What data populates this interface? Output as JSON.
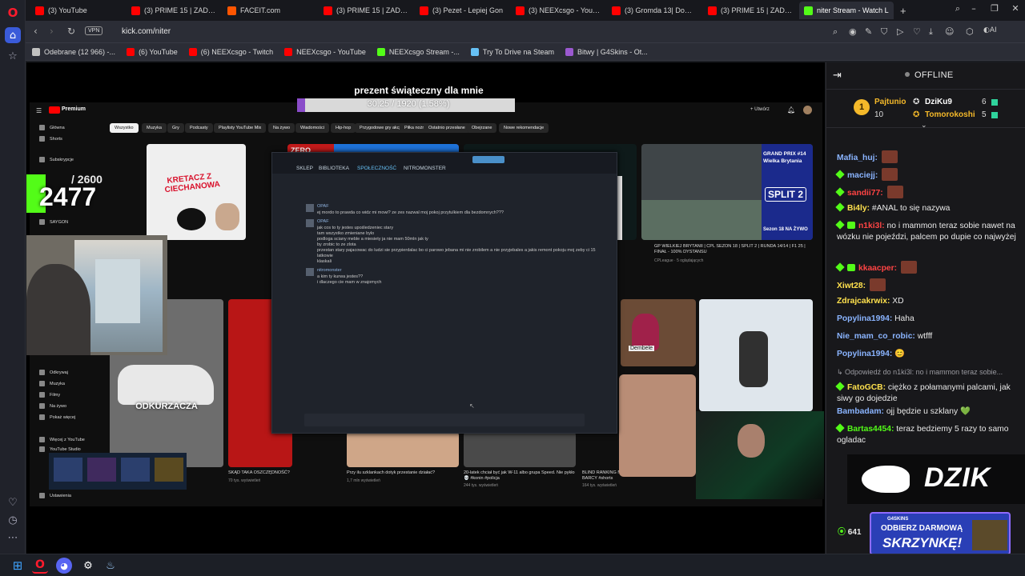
{
  "tabs": [
    {
      "label": "(3) YouTube",
      "color": "#ff0000"
    },
    {
      "label": "(3) PRIME 15 | ZADYMA",
      "color": "#ff0000"
    },
    {
      "label": "FACEIT.com",
      "color": "#ff5500"
    },
    {
      "label": "(3) PRIME 15 | ZADYMA",
      "color": "#ff0000"
    },
    {
      "label": "(3) Pezet - Lepiej Gon",
      "color": "#ff0000"
    },
    {
      "label": "(3) NEEXcsgo - YouTube",
      "color": "#ff0000"
    },
    {
      "label": "(3) Gromda 13| Dominik A",
      "color": "#ff0000"
    },
    {
      "label": "(3) PRIME 15 | ZADYMA",
      "color": "#ff0000"
    },
    {
      "label": "niter Stream - Watch L",
      "color": "#53fc18"
    }
  ],
  "address": {
    "vpn": "VPN",
    "url": "kick.com/niter"
  },
  "bookmarks": [
    {
      "label": "Odebrane (12 966) -...",
      "color": "#c0c0c0"
    },
    {
      "label": "(6) YouTube",
      "color": "#ff0000"
    },
    {
      "label": "(6) NEEXcsgo - Twitch",
      "color": "#ff0000"
    },
    {
      "label": "NEEXcsgo - YouTube",
      "color": "#ff0000"
    },
    {
      "label": "NEEXcsgo Stream -...",
      "color": "#53fc18"
    },
    {
      "label": "Try To Drive na Steam",
      "color": "#66c0f4"
    },
    {
      "label": "Bitwy | G4Skins - Ot...",
      "color": "#9b59d0"
    }
  ],
  "stream": {
    "donation_title": "prezent świąteczny dla mnie",
    "donation_progress": "30.25 / 1920 (1.58%)",
    "donation_fraction": 0.0158,
    "counter_goal": "/ 2600",
    "counter_value": "2477",
    "steam_tabs": [
      "SKLEP",
      "BIBLIOTEKA",
      "SPOŁECZNOŚĆ",
      "NITROMONSTER"
    ],
    "steam_messages": [
      {
        "name": "OPAF",
        "text": "ej mordo to prawda co widz mi mowi? ze zes nazwal moj pokoj przytulkiem dla bezdomnych???"
      },
      {
        "name": "OPAF",
        "text": "jak cos to ty jestes upośledzeniec stary"
      },
      {
        "name": "",
        "text": "tam wszystko zmieniane bylo"
      },
      {
        "name": "",
        "text": "podloga sciany meble a miesiety ja nie mam 50mln jak ty"
      },
      {
        "name": "",
        "text": "by zrobic to ze zlota"
      },
      {
        "name": "",
        "text": "przestan stary pajacowac do ludzi sie przypierdalac bo ci parowo jebana mi nie zrobilem a nie przyjebales a jakis remont pokoju moj zeby ci 15 latkowie"
      },
      {
        "name": "",
        "text": "klaskali"
      },
      {
        "name": "nitromonster",
        "text": "a kim ty kurwa jestes??"
      },
      {
        "name": "",
        "text": "i dlaczego cie mam w znajomych"
      }
    ],
    "yt": {
      "chips": [
        "Wszystko",
        "Muzyka",
        "Gry",
        "Podcasty",
        "Playlisty YouTube Mix",
        "Na żywo",
        "Wiadomości",
        "Hip-hop",
        "Przygodowe gry akcji",
        "Piłka nożna",
        "Ostatnio przesłane",
        "Obejrzane",
        "Nowe rekomendacje"
      ],
      "sidebar": [
        "Główna",
        "Shorts",
        "Subskrypcje",
        "SAYGON",
        "Odkrywaj",
        "Muzyka",
        "Filmy",
        "Na żywo",
        "Pokaż więcej",
        "Więcej z YouTube",
        "YouTube Studio",
        "Ustawienia"
      ],
      "captions": [
        {
          "title": "GP WIELKIEJ BRYTANII | CPL SEZON 18 | SPLIT 2 | RUNDA 14/14 | F1 25 | FINAŁ - 100% DYSTANSU",
          "sub": "CPLeague · 5 oglądających"
        },
        {
          "title": "SKĄD TAKA OSZCZĘDNOŚĆ?",
          "sub": "70 tys. wyświetleń"
        },
        {
          "title": "Przy ilu szklankach dotyk przestanie działać?",
          "sub": "1,7 mln wyświetleń"
        },
        {
          "title": "20-latek chciał być jak W-11 albo grupa Speed. Nie pykło 💀 #konin #policja",
          "sub": "244 tys. wyświetleń"
        },
        {
          "title": "BLIND RANKING NAJGORSZYCH TRANSFERÓW BARCY #shorts",
          "sub": "164 tys. wyświetleń"
        }
      ],
      "thumb_texts": {
        "kretacz": "KRETACZ Z CIECHANOWA",
        "odkurzacza": "ODKURZACZA",
        "gp": "GRAND PRIX #14 Wielka Brytania",
        "split": "SPLIT 2",
        "sezon": "Sezon 18 NA ŻYWO",
        "dembele": "Dembele"
      }
    }
  },
  "chat": {
    "status": "OFFLINE",
    "gifters": [
      {
        "name": "Pajtunio",
        "count": "10",
        "color": "#f5b92a"
      },
      {
        "name": "DziKu9",
        "count": "6",
        "color": "#ffffff"
      },
      {
        "name": "Tomorokoshi",
        "count": "5",
        "color": "#f5b92a"
      }
    ],
    "messages": [
      {
        "user": "Mafia_huj:",
        "color": "#8ab4ff",
        "text": "",
        "emote": true
      },
      {
        "user": "maciejj:",
        "color": "#8ab4ff",
        "text": "",
        "emote": true,
        "badge": "dia"
      },
      {
        "user": "sandii77:",
        "color": "#ff4444",
        "text": "",
        "emote": true,
        "badge": "dia"
      },
      {
        "user": "Bi4ly:",
        "color": "#ffe14d",
        "text": "#ANAL to się nazywa",
        "badge": "dia"
      },
      {
        "user": "n1ki3l:",
        "color": "#ff4444",
        "text": "no i mammon teraz sobie nawet na wózku nie pojeździ, palcem po dupie co najwyżej",
        "badge": "sub"
      },
      {
        "user": "kkaacper:",
        "color": "#ff4444",
        "text": "",
        "emote": true,
        "badge": "sub"
      },
      {
        "user": "Xiwt28:",
        "color": "#ffe14d",
        "text": "",
        "emote": true
      },
      {
        "user": "Zdrajcakrwix:",
        "color": "#ffe14d",
        "text": "XD"
      },
      {
        "user": "Popylina1994:",
        "color": "#8ab4ff",
        "text": "Haha"
      },
      {
        "user": "Nie_mam_co_robic:",
        "color": "#8ab4ff",
        "text": "wtfff"
      },
      {
        "user": "Popylina1994:",
        "color": "#8ab4ff",
        "text": "😊"
      },
      {
        "user": "",
        "color": "#9a9aa0",
        "text": "↳ Odpowiedź do n1ki3l: no i mammon teraz sobie..."
      },
      {
        "user": "FatoGCB:",
        "color": "#ffe14d",
        "text": "ciężko z połamanymi palcami, jak siwy go dojedzie",
        "badge": "dia"
      },
      {
        "user": "Bambadam:",
        "color": "#8ab4ff",
        "text": "ojj będzie u szklany 💚"
      },
      {
        "user": "Bartas4454:",
        "color": "#53fc18",
        "text": "teraz bedziemy 5 razy to samo ogladac",
        "badge": "dia"
      }
    ],
    "dzik_text": "DZIK",
    "promo_brand": "G4SKINS",
    "promo_line1": "ODBIERZ DARMOWĄ",
    "promo_line2": "SKRZYNKĘ!",
    "viewer_count": "641"
  },
  "colors": {
    "kick_green": "#53fc18",
    "opera_red": "#ff1b2d",
    "chat_bg": "#18181b"
  }
}
